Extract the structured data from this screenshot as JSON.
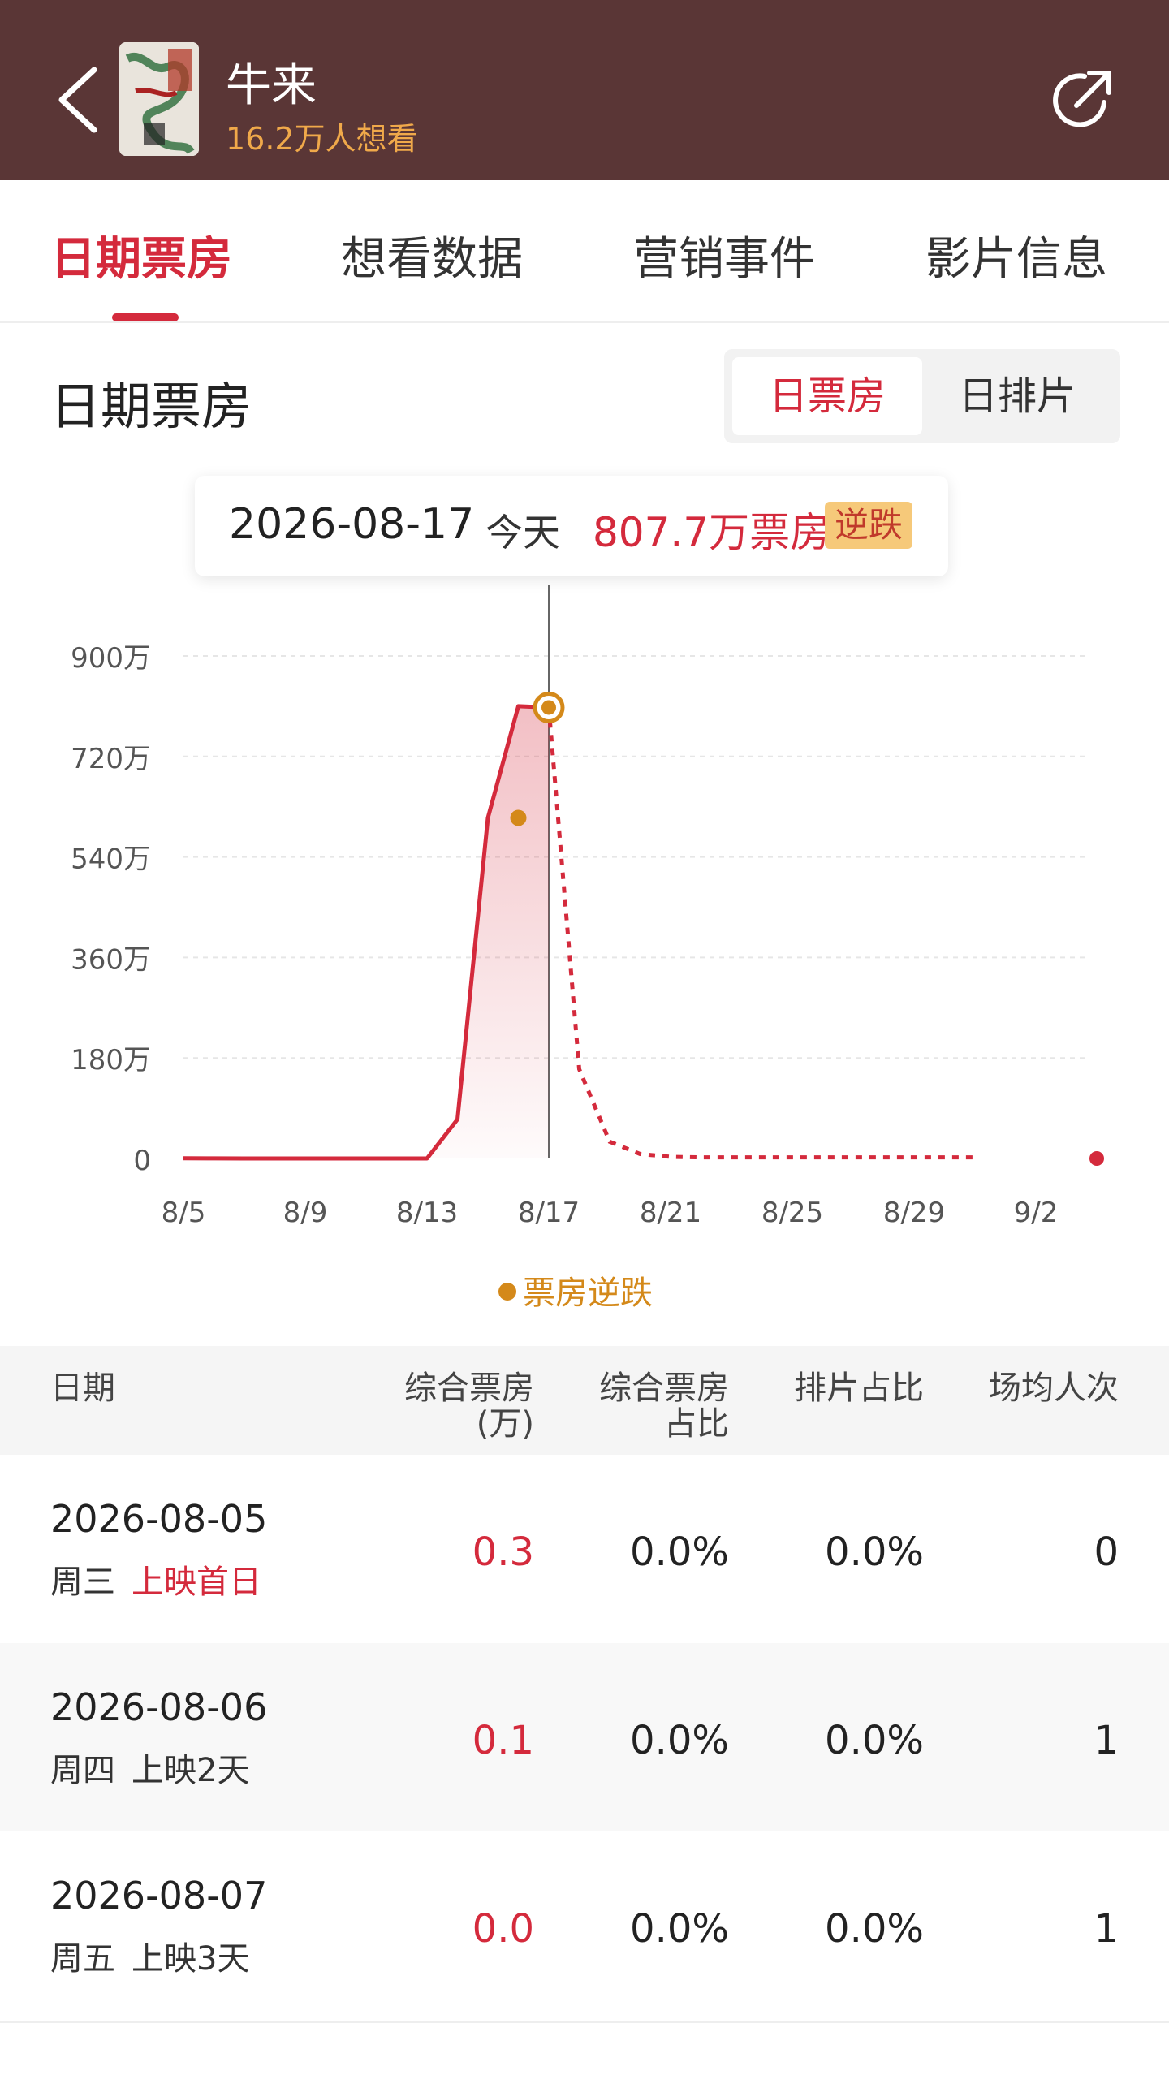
{
  "header": {
    "title": "牛来",
    "want_count": "16.2万人想看",
    "colors": {
      "bg": "#5a3636",
      "accent": "#f0a94a"
    },
    "icons": {
      "back": "chevron-left-icon",
      "share": "share-icon"
    }
  },
  "tabs": [
    {
      "label": "日期票房",
      "active": true
    },
    {
      "label": "想看数据",
      "active": false
    },
    {
      "label": "营销事件",
      "active": false
    },
    {
      "label": "影片信息",
      "active": false
    }
  ],
  "section": {
    "title": "日期票房",
    "toggle": {
      "active": "日票房",
      "inactive": "日排片"
    }
  },
  "tooltip": {
    "date": "2026-08-17",
    "today": "今天",
    "value": "807.7万票房",
    "badge": "逆跌"
  },
  "chart_data": {
    "type": "line",
    "x_ticks": [
      "8/5",
      "8/9",
      "8/13",
      "8/17",
      "8/21",
      "8/25",
      "8/29",
      "9/2"
    ],
    "y_ticks": [
      "900万",
      "720万",
      "540万",
      "360万",
      "180万",
      "0"
    ],
    "ylim": [
      0,
      900
    ],
    "grid": true,
    "actual": {
      "x": [
        "8/5",
        "8/6",
        "8/7",
        "8/8",
        "8/9",
        "8/10",
        "8/11",
        "8/12",
        "8/13",
        "8/14",
        "8/15",
        "8/16",
        "8/17"
      ],
      "values": [
        0.3,
        0.1,
        0.0,
        0,
        0,
        0,
        0,
        0,
        0,
        70,
        610,
        810,
        807.7
      ]
    },
    "forecast": {
      "x": [
        "8/17",
        "8/18",
        "8/19",
        "8/20",
        "8/21",
        "8/22",
        "8/23",
        "8/24",
        "8/25",
        "8/26",
        "8/27",
        "8/28",
        "8/29",
        "8/30",
        "8/31"
      ],
      "values": [
        807.7,
        160,
        30,
        8,
        3,
        2,
        2,
        2,
        2,
        2,
        2,
        2,
        2,
        2,
        2
      ]
    },
    "highlight_points": [
      {
        "x": "8/16",
        "value": 610,
        "label": "票房逆跌"
      },
      {
        "x": "8/17",
        "value": 807.7,
        "label": "票房逆跌"
      }
    ],
    "end_point": {
      "x": "9/4",
      "value": 0
    },
    "legend": "票房逆跌",
    "colors": {
      "line": "#d42a3c",
      "highlight": "#d4891a",
      "grid": "#e6e6e6"
    }
  },
  "table": {
    "headers": {
      "date": "日期",
      "box_office_1": "综合票房",
      "box_office_2": "(万)",
      "share_1": "综合票房",
      "share_2": "占比",
      "schedule": "排片占比",
      "avg": "场均人次"
    },
    "rows": [
      {
        "date": "2026-08-05",
        "weekday": "周三",
        "day_label": "上映首日",
        "box_office": "0.3",
        "share": "0.0%",
        "schedule": "0.0%",
        "avg": "0"
      },
      {
        "date": "2026-08-06",
        "weekday": "周四",
        "day_label": "上映2天",
        "box_office": "0.1",
        "share": "0.0%",
        "schedule": "0.0%",
        "avg": "1"
      },
      {
        "date": "2026-08-07",
        "weekday": "周五",
        "day_label": "上映3天",
        "box_office": "0.0",
        "share": "0.0%",
        "schedule": "0.0%",
        "avg": "1"
      }
    ]
  }
}
